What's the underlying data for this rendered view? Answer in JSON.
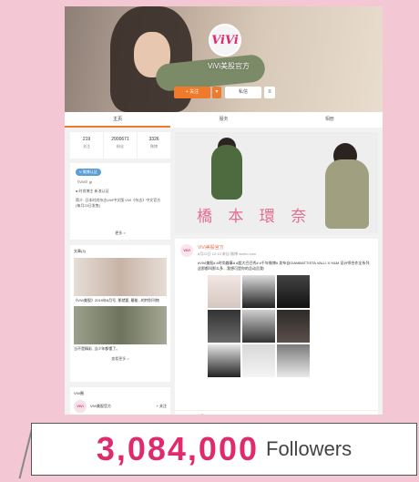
{
  "profile": {
    "avatar_logo": "ViVi",
    "name": "ViVi美股官方",
    "follow_label": "+ 关注",
    "message_label": "私信",
    "tabs": [
      "主页",
      "服务",
      "相册"
    ]
  },
  "stats": [
    {
      "value": "219",
      "label": "关注"
    },
    {
      "value": "2900671",
      "label": "粉丝"
    },
    {
      "value": "3326",
      "label": "微博"
    }
  ],
  "info": {
    "badge": "V 微博认证",
    "lines": [
      "《ViVi》jp",
      "● 时尚博主 新浪认证",
      "简介: 日本时尚杂志ViVi中文版 ViVi《杂志》中文官方 (每月23日发售)"
    ],
    "more": "更多 >"
  },
  "photo": {
    "caption": "橋 本 環 奈"
  },
  "articles": {
    "header": "文章(3)",
    "items": [
      {
        "title": "《ViVi美股》2019年8月号, 那就要, 最能...的特别刊物"
      },
      {
        "title": "当不是精彩, 当少年都懂了。"
      }
    ],
    "more": "查看更多 >"
  },
  "vivi_block": {
    "header": "ViVi圈",
    "name": "ViVi美股官方",
    "add": "+ 关注"
  },
  "post": {
    "avatar": "ViVi",
    "name": "ViVi美股官方",
    "time": "8月22日 12:10 来自 微博 weibo.com",
    "text": "#ViVi美股# #时尚趣事# #超大巴巴秀# #千年微博# 发布自GIAMBATTISTA VALLI X H&M 设计师合作全系列, 这那都叫那么多…我想可是你的总动员我!",
    "footer": [
      "收藏",
      "28",
      "133",
      "1994"
    ]
  },
  "banner": {
    "count": "3,084,000",
    "label": "Followers"
  },
  "colors": {
    "background": "#f4c7d4",
    "accent": "#e12a6d",
    "orange": "#f07a2c"
  }
}
